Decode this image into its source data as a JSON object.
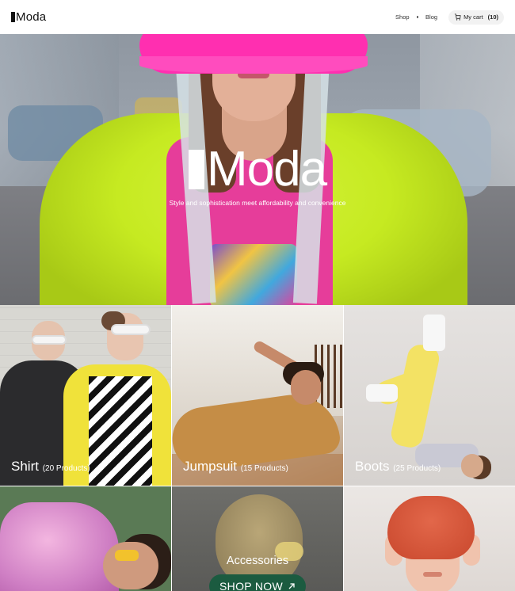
{
  "header": {
    "logo_text": "Moda",
    "nav": [
      {
        "label": "Shop"
      },
      {
        "label": "Blog"
      }
    ],
    "cart": {
      "label": "My cart",
      "count": "(10)"
    }
  },
  "hero": {
    "title": "Moda",
    "tagline": "Style and sophistication meet affordability and convenience"
  },
  "categories": [
    {
      "name": "Shirt",
      "count": "(20 Products)"
    },
    {
      "name": "Jumpsuit",
      "count": "(15 Products)"
    },
    {
      "name": "Boots",
      "count": "(25 Products)"
    }
  ],
  "accessories": {
    "title": "Accessories",
    "button_label": "SHOP NOW"
  },
  "colors": {
    "hat_pink": "#ff2fb0",
    "jacket_lime": "#c6ea21",
    "button_green": "#1b5b40"
  }
}
